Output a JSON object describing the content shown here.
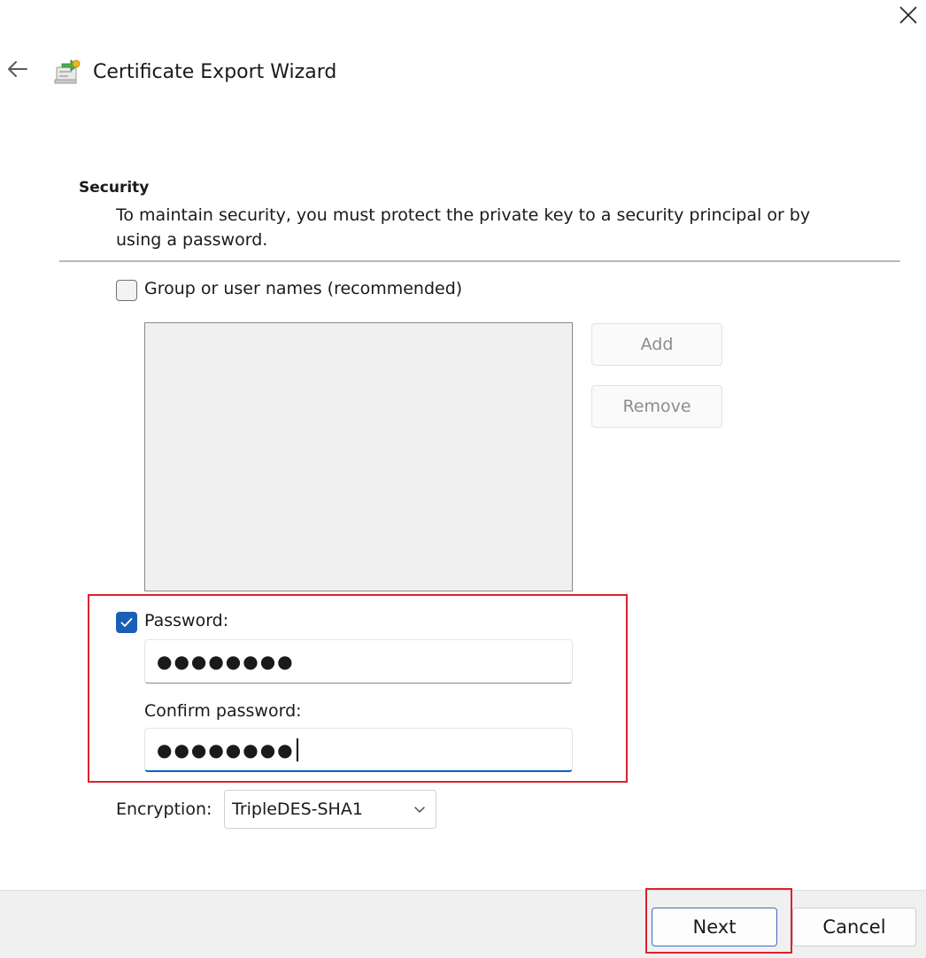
{
  "window": {
    "title": "Certificate Export Wizard",
    "close_icon": "close-icon",
    "back_icon": "arrow-left-icon",
    "app_icon": "certificate-export-icon"
  },
  "section": {
    "title": "Security",
    "description": "To maintain security, you must protect the private key to a security principal or by using a password."
  },
  "group_users": {
    "checkbox_label": "Group or user names (recommended)",
    "checked": false,
    "add_label": "Add",
    "remove_label": "Remove",
    "items": []
  },
  "password": {
    "checkbox_label": "Password:",
    "checked": true,
    "value": "●●●●●●●●",
    "confirm_label": "Confirm password:",
    "confirm_value": "●●●●●●●●"
  },
  "encryption": {
    "label": "Encryption:",
    "selected": "TripleDES-SHA1",
    "chevron_icon": "chevron-down-icon"
  },
  "footer": {
    "next_label": "Next",
    "cancel_label": "Cancel"
  },
  "colors": {
    "accent": "#1a5fb4",
    "highlight": "#d9232e",
    "footer_bg": "#f0f0f0"
  }
}
